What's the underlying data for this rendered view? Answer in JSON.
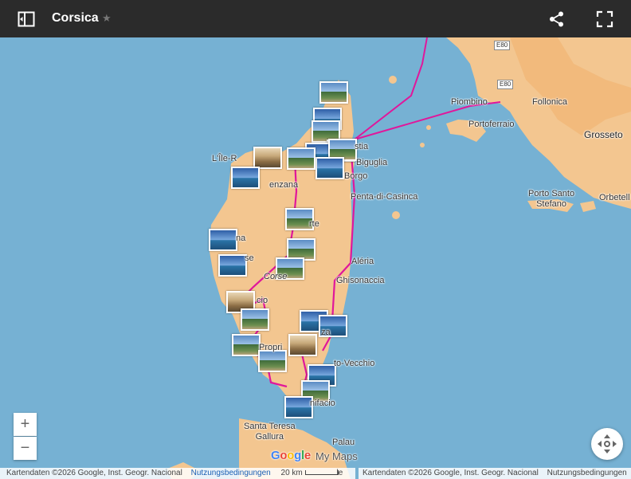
{
  "header": {
    "title": "Corsica",
    "star_glyph": "★"
  },
  "map": {
    "place_labels": {
      "piombino": "Piombino",
      "follonica": "Follonica",
      "portoferraio": "Portoferraio",
      "grosseto": "Grosseto",
      "porto_santo_stefano": "Porto Santo\nStefano",
      "orbetello": "Orbetell",
      "bastia": "stia",
      "biguglia": "Biguglia",
      "borgo": "Borgo",
      "ile_rousse": "L'Île-R",
      "lenzana": "enzana",
      "penta": "Penta-di-Casinca",
      "corte": "rte",
      "calvi_frag": "na",
      "frag_se": "se",
      "aleria": "Aléria",
      "corse": "Corse",
      "ghisonaccia": "Ghisonaccia",
      "ajaccio": "cio",
      "propriano": "Propri",
      "porto_vecchio": "to-Vecchio",
      "za": "za",
      "bonifacio": "nifacio",
      "santa_teresa": "Santa Teresa\nGallura",
      "palau": "Palau",
      "e80_a": "E80",
      "e80_b": "E80"
    }
  },
  "controls": {
    "zoom_in": "+",
    "zoom_out": "−"
  },
  "footer": {
    "attribution_left": "Kartendaten ©2026 Google, Inst. Geogr. Nacional",
    "terms_left": "Nutzungsbedingungen",
    "scale": "20 km",
    "kurzbefehle_frag": "le",
    "attribution_right": "Kartendaten ©2026 Google, Inst. Geogr. Nacional",
    "terms_right": "Nutzungsbedingungen",
    "google_logo": "Google",
    "my_maps": "My Maps"
  },
  "colors": {
    "sea": "#76b1d3",
    "land": "#f3c690",
    "urban": "#f0b06c",
    "route": "#e0179b",
    "header_bg": "#2b2b2b"
  }
}
